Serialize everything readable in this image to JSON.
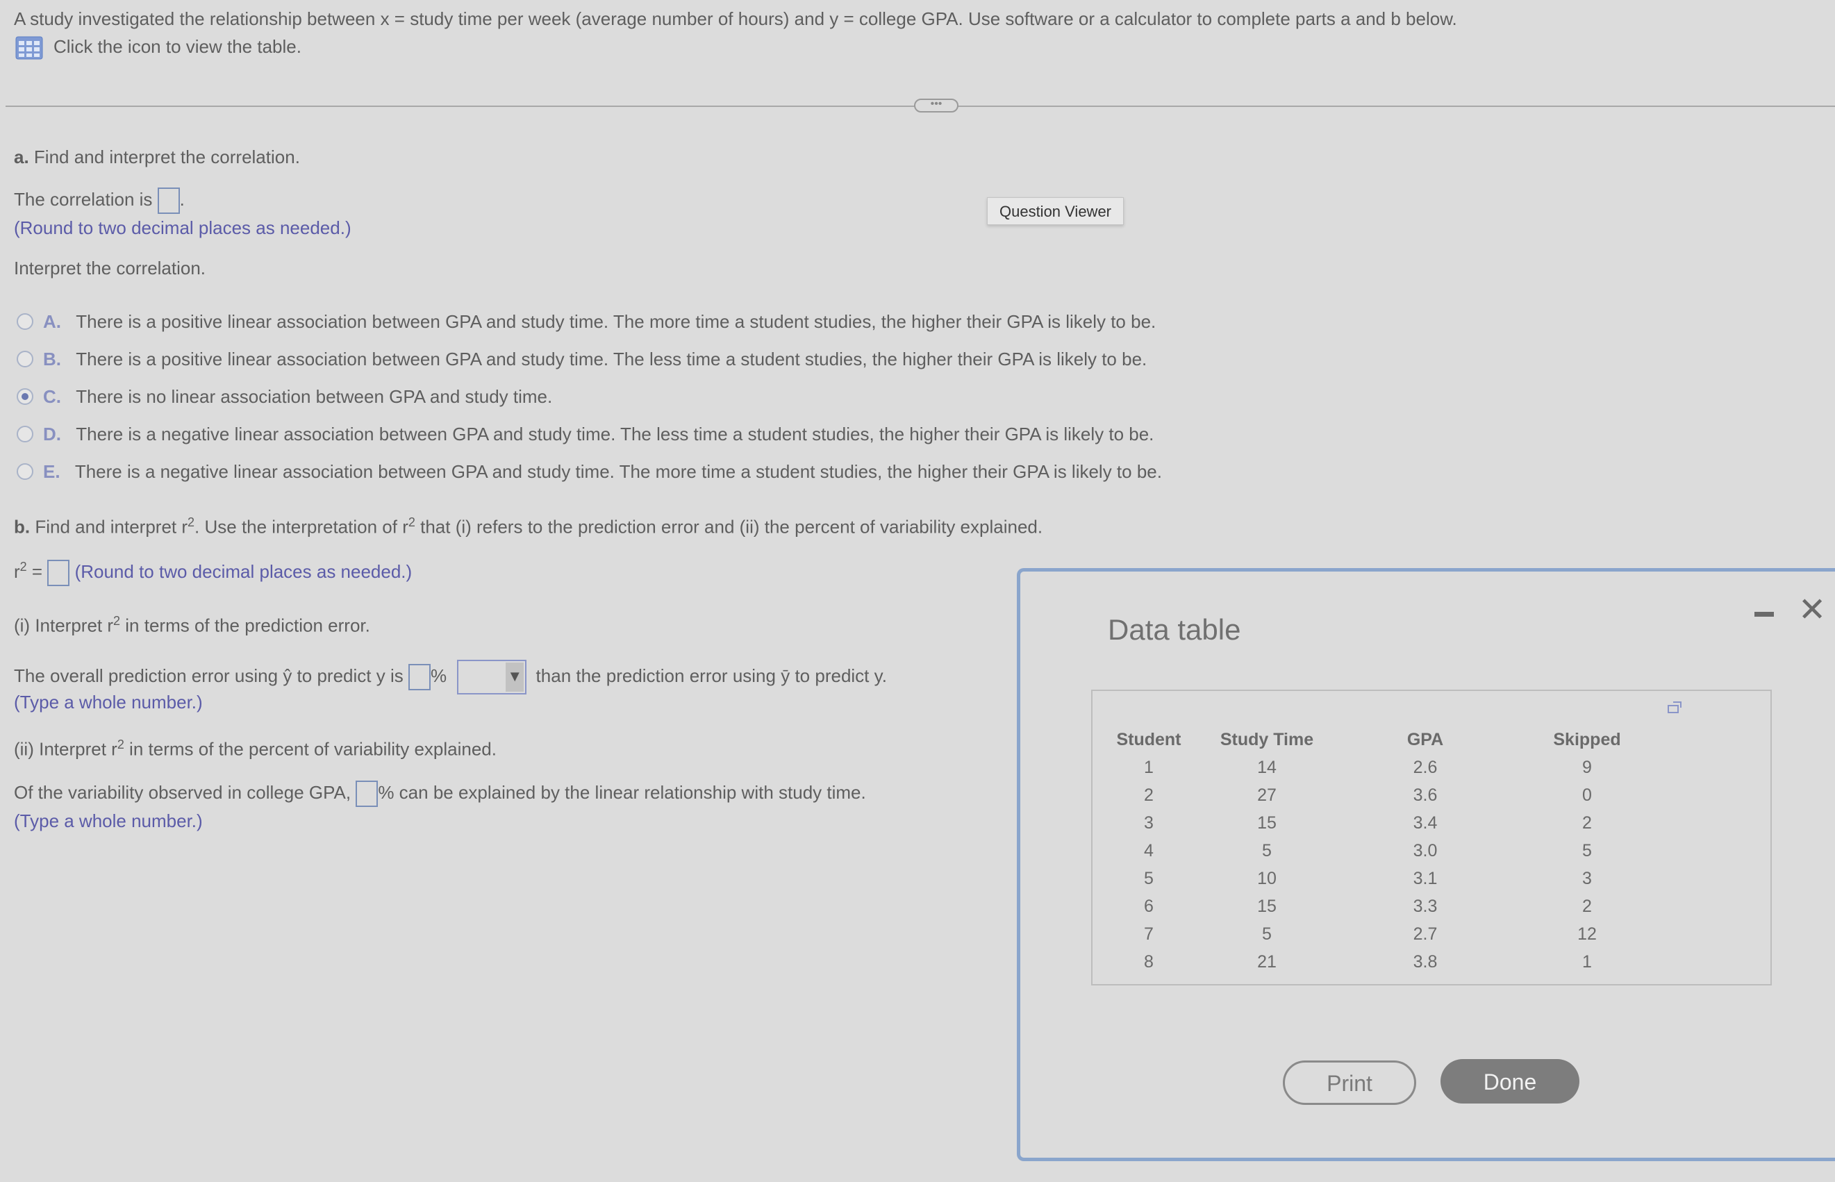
{
  "intro": {
    "line1": "A study investigated the relationship between x = study time per week (average number of hours) and y = college GPA. Use software or a calculator to complete parts a and b below.",
    "table_link": "Click the icon to view the table."
  },
  "question_viewer": "Question Viewer",
  "part_a": {
    "label": "a.",
    "title": "Find and interpret the correlation.",
    "correlation_prefix": "The correlation is",
    "correlation_suffix": ".",
    "round_hint": "(Round to two decimal places as needed.)",
    "interpret_prompt": "Interpret the correlation.",
    "selected": "C",
    "options": [
      {
        "letter": "A.",
        "text": "There is a positive linear association between GPA and study time. The more time a student studies, the higher their GPA is likely to be."
      },
      {
        "letter": "B.",
        "text": "There is a positive linear association between GPA and study time. The less time a student studies, the higher their GPA is likely to be."
      },
      {
        "letter": "C.",
        "text": "There is no linear association between GPA and study time."
      },
      {
        "letter": "D.",
        "text": "There is a negative linear association between GPA and study time. The less time a student studies, the higher their GPA is likely to be."
      },
      {
        "letter": "E.",
        "text": "There is a negative linear association between GPA and study time. The more time a student studies, the higher their GPA is likely to be."
      }
    ]
  },
  "part_b": {
    "label": "b.",
    "title_1": "Find and interpret r",
    "title_2": ". Use the interpretation of r",
    "title_3": " that (i) refers to the prediction error and (ii) the percent of variability explained.",
    "sup": "2",
    "r2_prefix": "r",
    "r2_eq": " =",
    "r2_hint": "(Round to two decimal places as needed.)",
    "i_prompt_1": "(i) Interpret r",
    "i_prompt_2": " in terms of the prediction error.",
    "i_sentence_1": "The overall prediction error using",
    "i_yhat": "ŷ",
    "i_sentence_2": "to predict y is",
    "i_percent": "%",
    "i_sentence_3": "than the prediction error using",
    "i_ybar": "ȳ",
    "i_sentence_4": "to predict y.",
    "i_hint": "(Type a whole number.)",
    "ii_prompt_1": "(ii) Interpret r",
    "ii_prompt_2": " in terms of the percent of variability explained.",
    "ii_sentence_1": "Of the variability observed in college GPA,",
    "ii_sentence_2": "% can be explained by the linear relationship with study time.",
    "ii_hint": "(Type a whole number.)"
  },
  "modal": {
    "title": "Data table",
    "columns": [
      "Student",
      "Study Time",
      "GPA",
      "Skipped"
    ],
    "rows": [
      [
        "1",
        "14",
        "2.6",
        "9"
      ],
      [
        "2",
        "27",
        "3.6",
        "0"
      ],
      [
        "3",
        "15",
        "3.4",
        "2"
      ],
      [
        "4",
        "5",
        "3.0",
        "5"
      ],
      [
        "5",
        "10",
        "3.1",
        "3"
      ],
      [
        "6",
        "15",
        "3.3",
        "2"
      ],
      [
        "7",
        "5",
        "2.7",
        "12"
      ],
      [
        "8",
        "21",
        "3.8",
        "1"
      ]
    ],
    "print_label": "Print",
    "done_label": "Done",
    "divider_dots": "•••"
  }
}
